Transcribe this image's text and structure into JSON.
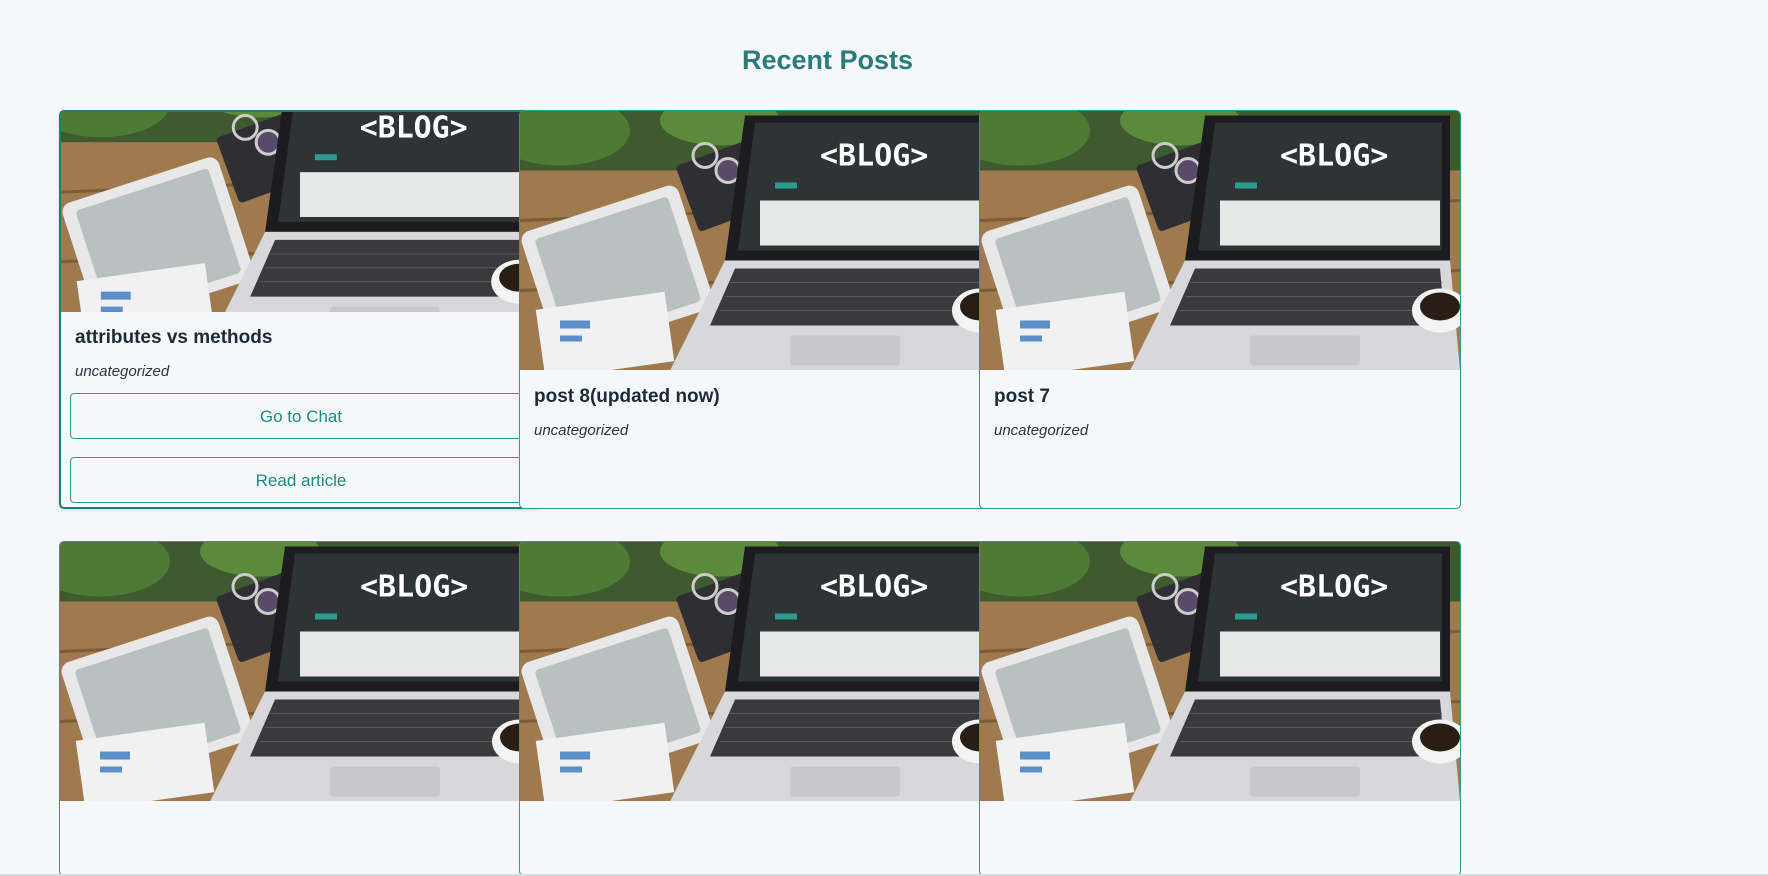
{
  "section": {
    "title": "Recent Posts"
  },
  "posts": [
    {
      "title": "attributes vs methods",
      "category": "uncategorized",
      "image_label": "<BLOG>",
      "chat_label": "Go to Chat",
      "read_label": "Read article"
    },
    {
      "title": "post 8(updated now)",
      "category": "uncategorized",
      "image_label": "<BLOG>"
    },
    {
      "title": "post 7",
      "category": "uncategorized",
      "image_label": "<BLOG>"
    },
    {
      "image_label": "<BLOG>"
    },
    {
      "image_label": "<BLOG>"
    },
    {
      "image_label": "<BLOG>"
    }
  ],
  "colors": {
    "accent": "#2a9d8f",
    "heading": "#2c7a7b",
    "text": "#1e2a38",
    "background": "#f4f8fb"
  }
}
